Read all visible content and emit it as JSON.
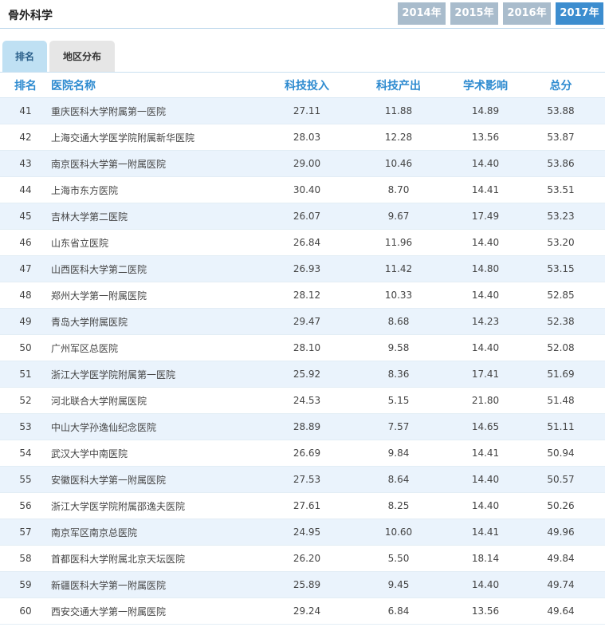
{
  "header": {
    "title": "骨外科学",
    "years": [
      "2014年",
      "2015年",
      "2016年",
      "2017年"
    ],
    "active_year": "2017年"
  },
  "tabs": [
    {
      "label": "排名"
    },
    {
      "label": "地区分布"
    }
  ],
  "table": {
    "columns": [
      "排名",
      "医院名称",
      "科技投入",
      "科技产出",
      "学术影响",
      "总分"
    ],
    "rows": [
      [
        "41",
        "重庆医科大学附属第一医院",
        "27.11",
        "11.88",
        "14.89",
        "53.88"
      ],
      [
        "42",
        "上海交通大学医学院附属新华医院",
        "28.03",
        "12.28",
        "13.56",
        "53.87"
      ],
      [
        "43",
        "南京医科大学第一附属医院",
        "29.00",
        "10.46",
        "14.40",
        "53.86"
      ],
      [
        "44",
        "上海市东方医院",
        "30.40",
        "8.70",
        "14.41",
        "53.51"
      ],
      [
        "45",
        "吉林大学第二医院",
        "26.07",
        "9.67",
        "17.49",
        "53.23"
      ],
      [
        "46",
        "山东省立医院",
        "26.84",
        "11.96",
        "14.40",
        "53.20"
      ],
      [
        "47",
        "山西医科大学第二医院",
        "26.93",
        "11.42",
        "14.80",
        "53.15"
      ],
      [
        "48",
        "郑州大学第一附属医院",
        "28.12",
        "10.33",
        "14.40",
        "52.85"
      ],
      [
        "49",
        "青岛大学附属医院",
        "29.47",
        "8.68",
        "14.23",
        "52.38"
      ],
      [
        "50",
        "广州军区总医院",
        "28.10",
        "9.58",
        "14.40",
        "52.08"
      ],
      [
        "51",
        "浙江大学医学院附属第一医院",
        "25.92",
        "8.36",
        "17.41",
        "51.69"
      ],
      [
        "52",
        "河北联合大学附属医院",
        "24.53",
        "5.15",
        "21.80",
        "51.48"
      ],
      [
        "53",
        "中山大学孙逸仙纪念医院",
        "28.89",
        "7.57",
        "14.65",
        "51.11"
      ],
      [
        "54",
        "武汉大学中南医院",
        "26.69",
        "9.84",
        "14.41",
        "50.94"
      ],
      [
        "55",
        "安徽医科大学第一附属医院",
        "27.53",
        "8.64",
        "14.40",
        "50.57"
      ],
      [
        "56",
        "浙江大学医学院附属邵逸夫医院",
        "27.61",
        "8.25",
        "14.40",
        "50.26"
      ],
      [
        "57",
        "南京军区南京总医院",
        "24.95",
        "10.60",
        "14.41",
        "49.96"
      ],
      [
        "58",
        "首都医科大学附属北京天坛医院",
        "26.20",
        "5.50",
        "18.14",
        "49.84"
      ],
      [
        "59",
        "新疆医科大学第一附属医院",
        "25.89",
        "9.45",
        "14.40",
        "49.74"
      ],
      [
        "60",
        "西安交通大学第一附属医院",
        "29.24",
        "6.84",
        "13.56",
        "49.64"
      ]
    ]
  }
}
